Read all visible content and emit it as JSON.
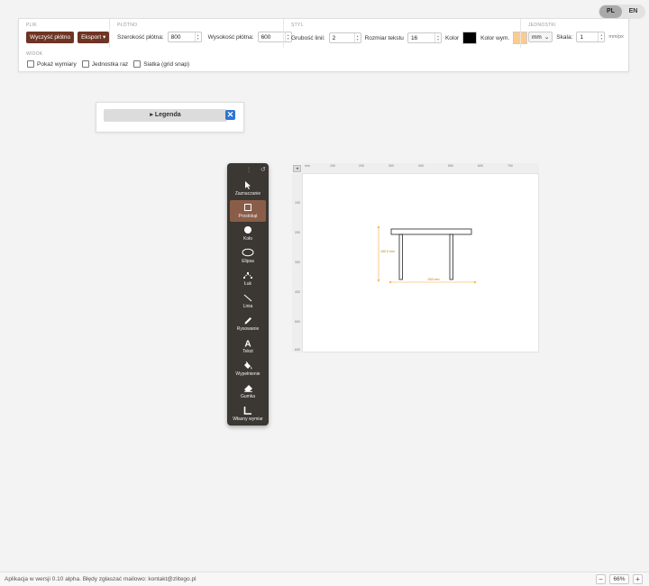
{
  "language": {
    "options": [
      "PL",
      "EN"
    ],
    "active": "PL"
  },
  "panel": {
    "file": {
      "title": "PLIK",
      "clear_label": "Wyczyść płótno",
      "export_label": "Eksport"
    },
    "canvas": {
      "title": "PŁÓTNO",
      "width_label": "Szerokość płótna:",
      "width_value": "800",
      "height_label": "Wysokość płótna:",
      "height_value": "600"
    },
    "style": {
      "title": "STYL",
      "line_width_label": "Grubość linii:",
      "line_width_value": "2",
      "text_size_label": "Rozmiar tekstu",
      "text_size_value": "16",
      "color_label": "Kolor",
      "color_value": "#000000",
      "dim_color_label": "Kolor wym.",
      "dim_color_value": "#fccb8e"
    },
    "units": {
      "title": "JEDNOSTKI",
      "unit_value": "mm",
      "scale_label": "Skala:",
      "scale_value": "1",
      "scale_unit": "mm/px"
    },
    "view": {
      "title": "WIDOK",
      "show_dims": "Pokaż wymiary",
      "unit_once": "Jednostka raz",
      "grid_snap": "Siatka (grid snap)"
    }
  },
  "legend": {
    "label": "▸ Legenda",
    "close": "✕"
  },
  "toolbar": {
    "tools": [
      {
        "label": "Zaznaczanie",
        "icon": "cursor-icon",
        "active": false
      },
      {
        "label": "Prostokąt",
        "icon": "rectangle-icon",
        "active": true
      },
      {
        "label": "Koło",
        "icon": "circle-icon",
        "active": false
      },
      {
        "label": "Elipsa",
        "icon": "ellipse-icon",
        "active": false
      },
      {
        "label": "Łuk",
        "icon": "arc-icon",
        "active": false
      },
      {
        "label": "Linia",
        "icon": "line-icon",
        "active": false
      },
      {
        "label": "Rysowanie",
        "icon": "pencil-icon",
        "active": false
      },
      {
        "label": "Tekst",
        "icon": "text-icon",
        "active": false
      },
      {
        "label": "Wypełnienie",
        "icon": "fill-icon",
        "active": false
      },
      {
        "label": "Gumka",
        "icon": "eraser-icon",
        "active": false
      },
      {
        "label": "Własny wymiar",
        "icon": "dimension-icon",
        "active": false
      }
    ]
  },
  "canvas": {
    "ruler_top": [
      "mm",
      "100",
      "200",
      "300",
      "400",
      "500",
      "600",
      "700"
    ],
    "ruler_left": [
      "100",
      "200",
      "300",
      "400",
      "500",
      "600"
    ],
    "dimensions": {
      "height_label": "150.0 mm",
      "width_label": "263 mm"
    }
  },
  "status": {
    "text": "Aplikacja w wersji 0.10 alpha. Błędy zgłaszać mailowo: kontakt@zlitego.pl",
    "zoom": "66%",
    "zoom_out": "−",
    "zoom_in": "+"
  }
}
